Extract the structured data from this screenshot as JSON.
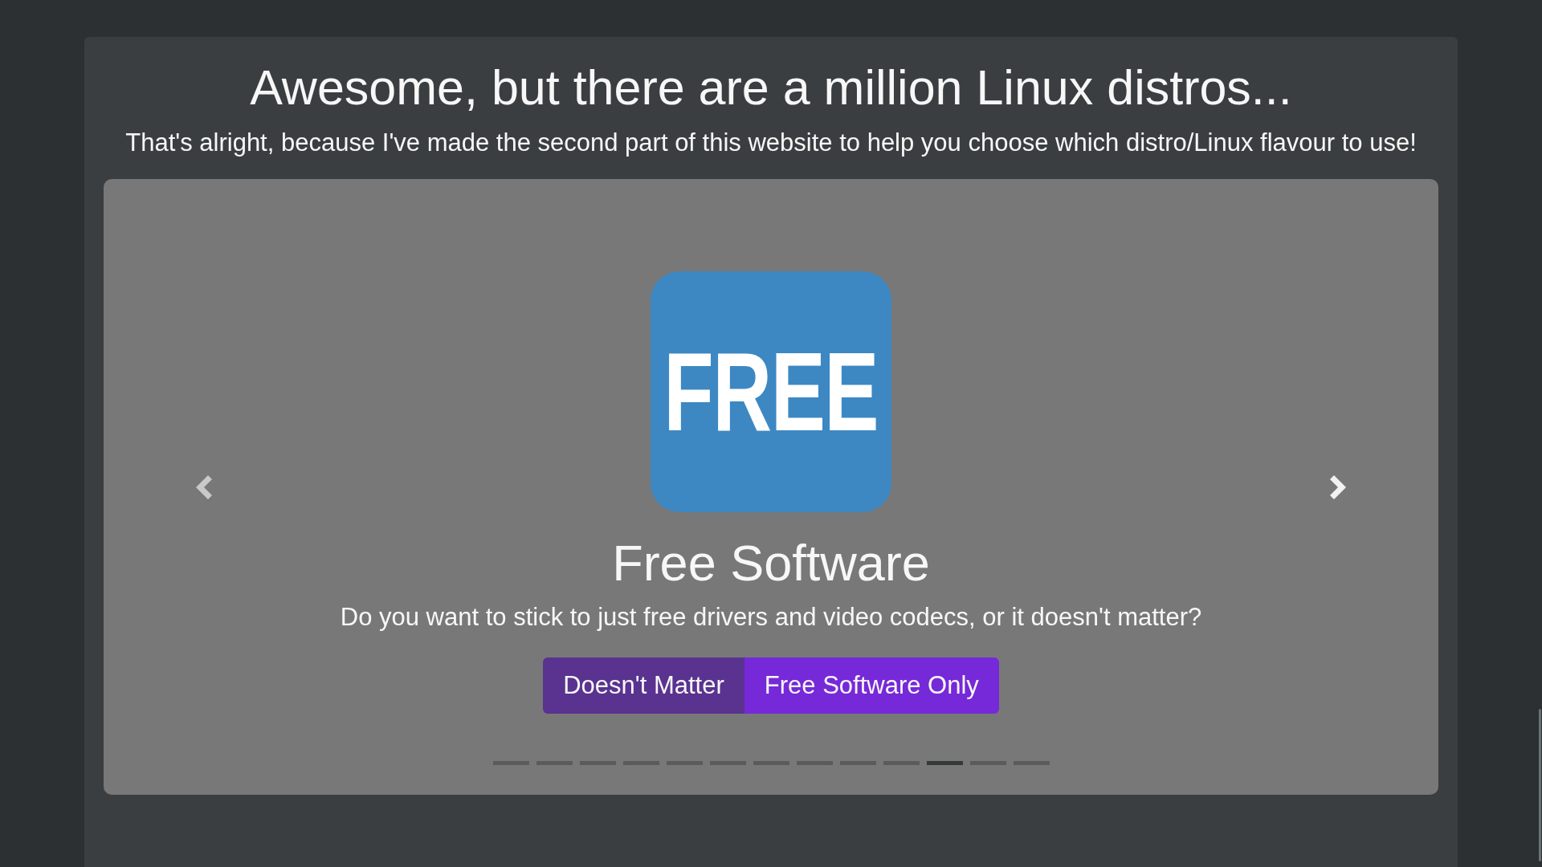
{
  "header": {
    "title": "Awesome, but there are a million Linux distros...",
    "subtitle": "That's alright, because I've made the second part of this website to help you choose which distro/Linux flavour to use!"
  },
  "carousel": {
    "slide": {
      "badge": "FREE",
      "title": "Free Software",
      "question": "Do you want to stick to just free drivers and video codecs, or it doesn't matter?",
      "options": [
        {
          "label": "Doesn't Matter",
          "selected": true
        },
        {
          "label": "Free Software Only",
          "selected": false
        }
      ]
    },
    "indicators": [
      {
        "selected": false
      },
      {
        "selected": false
      },
      {
        "selected": false
      },
      {
        "selected": false
      },
      {
        "selected": false
      },
      {
        "selected": false
      },
      {
        "selected": false
      },
      {
        "selected": false
      },
      {
        "selected": false
      },
      {
        "selected": false
      },
      {
        "selected": true
      },
      {
        "selected": false
      },
      {
        "selected": false
      }
    ]
  }
}
